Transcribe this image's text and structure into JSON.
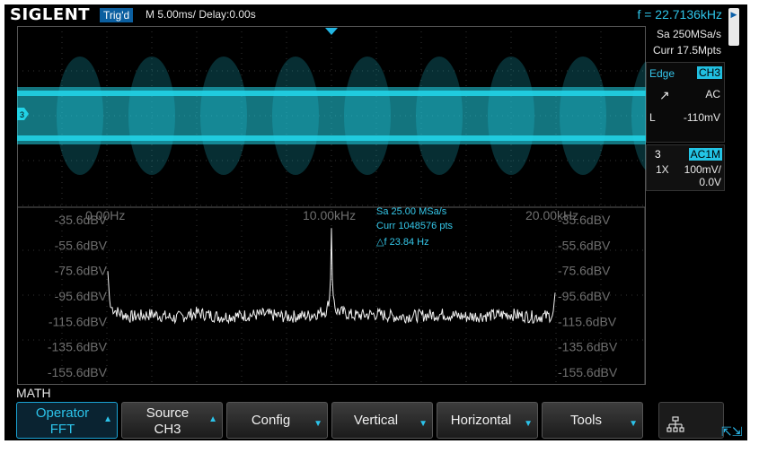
{
  "header": {
    "brand": "SIGLENT",
    "trigger_status": "Trig'd",
    "timebase": "M 5.00ms/ Delay:0.00s",
    "frequency": "f = 22.7136kHz",
    "sample_rate": "Sa 250MSa/s",
    "memory_depth": "Curr 17.5Mpts"
  },
  "trigger": {
    "type": "Edge",
    "source": "CH3",
    "slope_symbol": "↗",
    "coupling": "AC",
    "level_label": "L",
    "level": "-110mV"
  },
  "channel": {
    "number": "3",
    "coupling": "AC1M",
    "probe": "1X",
    "scale": "100mV/",
    "offset": "0.0V",
    "marker": "3"
  },
  "fft": {
    "freq_labels": [
      "0.00Hz",
      "10.00kHz",
      "20.00kHz"
    ],
    "db_labels": [
      "-35.6dBV",
      "-55.6dBV",
      "-75.6dBV",
      "-95.6dBV",
      "-115.6dBV",
      "-135.6dBV",
      "-155.6dBV"
    ],
    "sample_rate": "Sa 25.00 MSa/s",
    "points": "Curr 1048576 pts",
    "resolution": "△f 23.84 Hz"
  },
  "chart_data": {
    "type": "line",
    "title": "",
    "xlabel": "",
    "ylabel": "",
    "xlim": [
      0,
      24000
    ],
    "ylim": [
      -165.6,
      -25.6
    ],
    "x_ticks": [
      "0.00Hz",
      "10.00kHz",
      "20.00kHz"
    ],
    "y_ticks": [
      "-35.6dBV",
      "-55.6dBV",
      "-75.6dBV",
      "-95.6dBV",
      "-115.6dBV",
      "-135.6dBV",
      "-155.6dBV"
    ],
    "series": [
      {
        "x": [
          0,
          100,
          500,
          1000,
          2000,
          3000,
          4000,
          5000,
          6000,
          7000,
          8000,
          9000,
          9800,
          9950,
          10000,
          10050,
          10200,
          11000,
          12000,
          13000,
          14000,
          15000,
          16000,
          17000,
          18000,
          19000,
          19900,
          20000
        ],
        "y": [
          -76,
          -104,
          -109,
          -112,
          -110,
          -113,
          -109,
          -112,
          -111,
          -110,
          -112,
          -111,
          -107,
          -92,
          -42,
          -92,
          -107,
          -111,
          -110,
          -112,
          -111,
          -110,
          -112,
          -111,
          -110,
          -112,
          -111,
          -93
        ]
      }
    ]
  },
  "math_label": "MATH",
  "softkeys": [
    {
      "label": "Operator",
      "value": "FFT"
    },
    {
      "label": "Source",
      "value": "CH3"
    },
    {
      "label": "Config"
    },
    {
      "label": "Vertical"
    },
    {
      "label": "Horizontal"
    },
    {
      "label": "Tools"
    }
  ],
  "icons": {
    "network": "network-icon",
    "expand": "expand-icon"
  },
  "colors": {
    "channel3": "#22d3e6",
    "fft_trace": "#f2f2f2",
    "grid_label": "#6f6f6f",
    "accent": "#2cc3ea"
  }
}
